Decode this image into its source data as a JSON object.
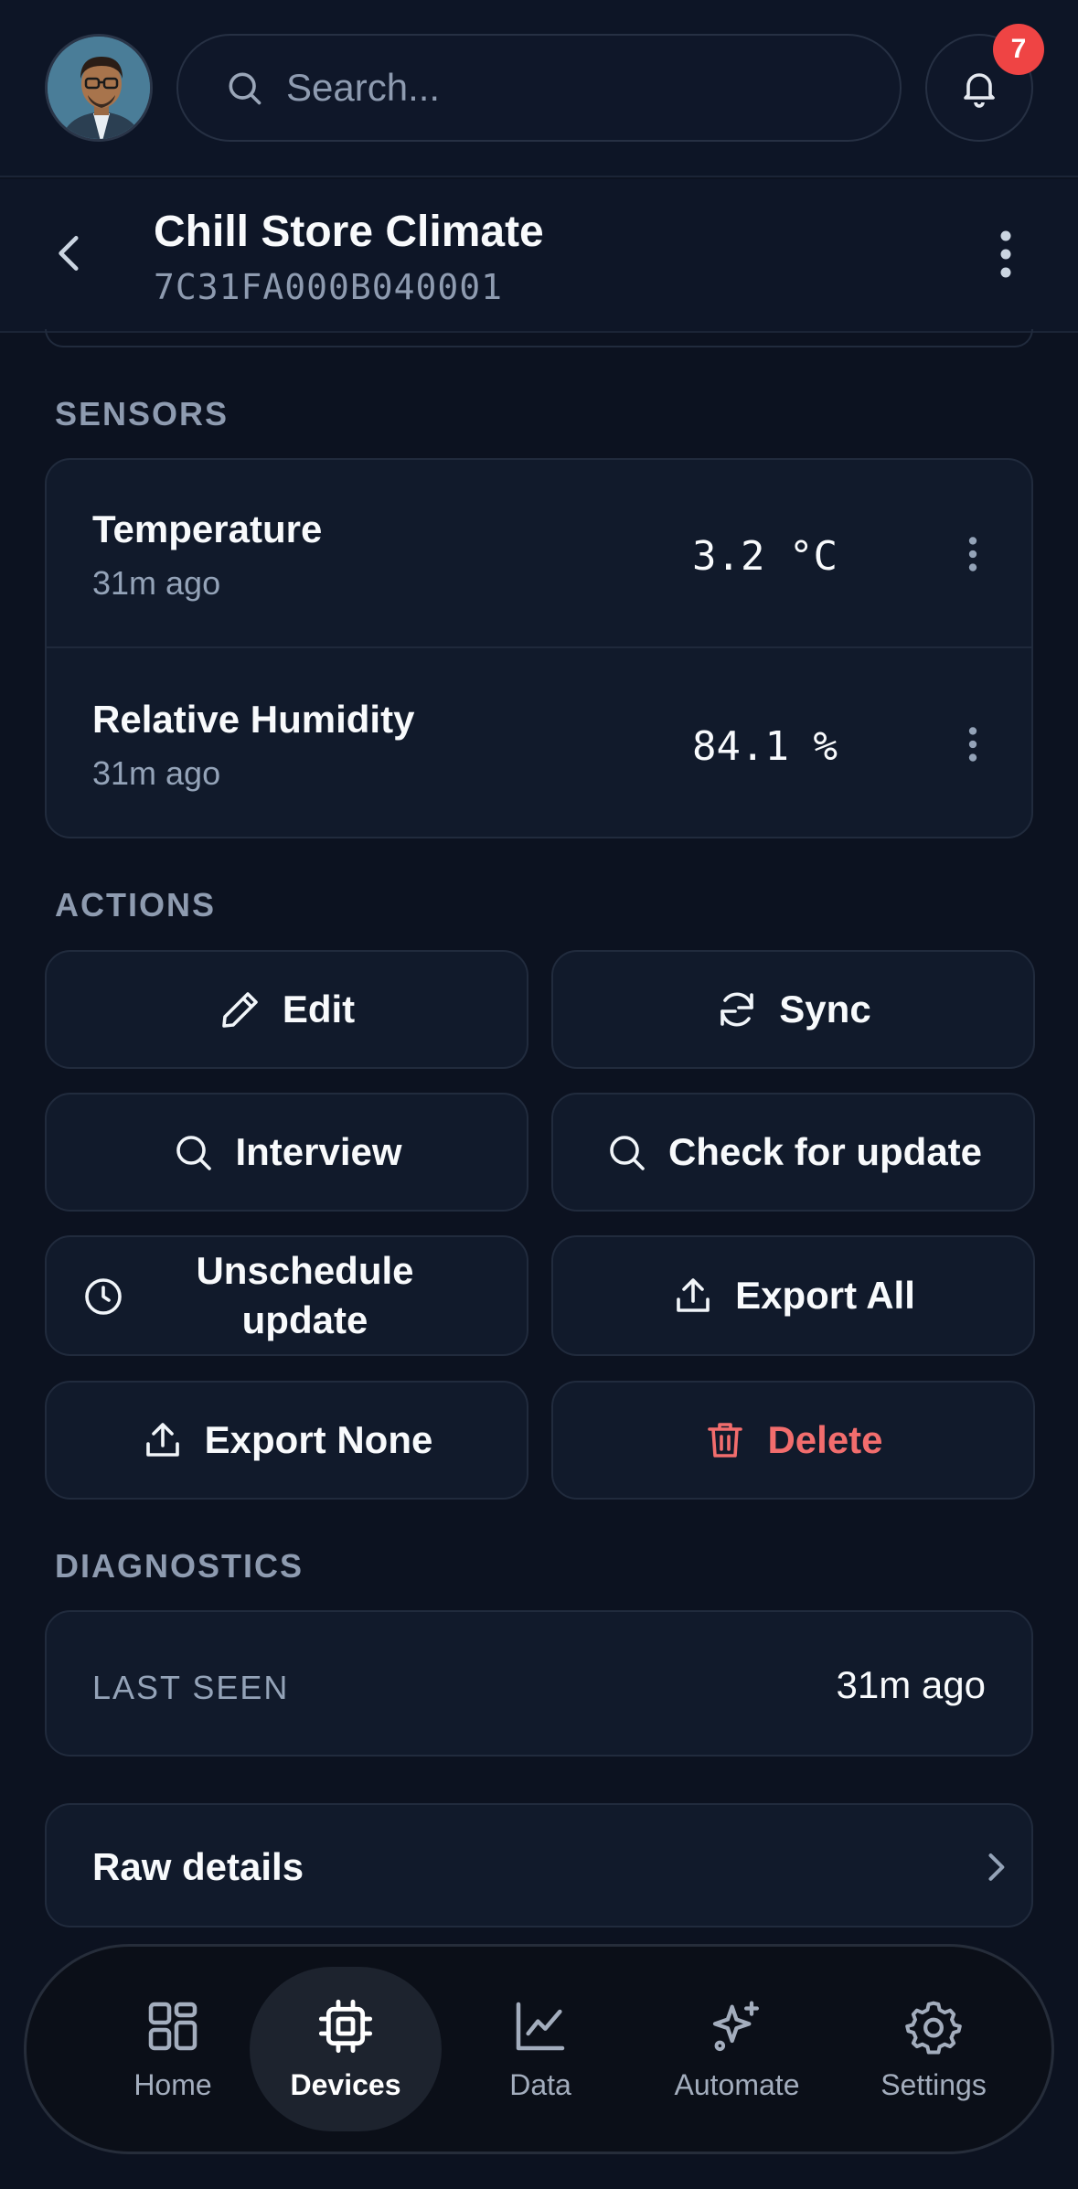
{
  "topbar": {
    "search_placeholder": "Search...",
    "notification_count": "7"
  },
  "header": {
    "title": "Chill Store Climate",
    "device_id": "7C31FA000B040001"
  },
  "sensors": {
    "section_label": "SENSORS",
    "items": [
      {
        "name": "Temperature",
        "time": "31m ago",
        "value": "3.2 °C"
      },
      {
        "name": "Relative Humidity",
        "time": "31m ago",
        "value": "84.1 %"
      }
    ]
  },
  "actions": {
    "section_label": "ACTIONS",
    "edit": "Edit",
    "sync": "Sync",
    "interview": "Interview",
    "check_update": "Check for update",
    "unschedule_update": "Unschedule update",
    "export_all": "Export All",
    "export_none": "Export None",
    "delete": "Delete",
    "danger_color": "#f26d6d"
  },
  "diagnostics": {
    "section_label": "DIAGNOSTICS",
    "last_seen_label": "LAST SEEN",
    "last_seen_value": "31m ago",
    "raw_details": "Raw details"
  },
  "nav": {
    "items": [
      {
        "label": "Home",
        "icon": "grid-icon"
      },
      {
        "label": "Devices",
        "icon": "chip-icon",
        "active": true
      },
      {
        "label": "Data",
        "icon": "chart-line-icon"
      },
      {
        "label": "Automate",
        "icon": "sparkles-icon"
      },
      {
        "label": "Settings",
        "icon": "gear-icon"
      }
    ]
  },
  "colors": {
    "background": "#0c1220",
    "card": "#111a2b",
    "badge": "#ef4444",
    "muted_text": "#8e9bb0"
  }
}
